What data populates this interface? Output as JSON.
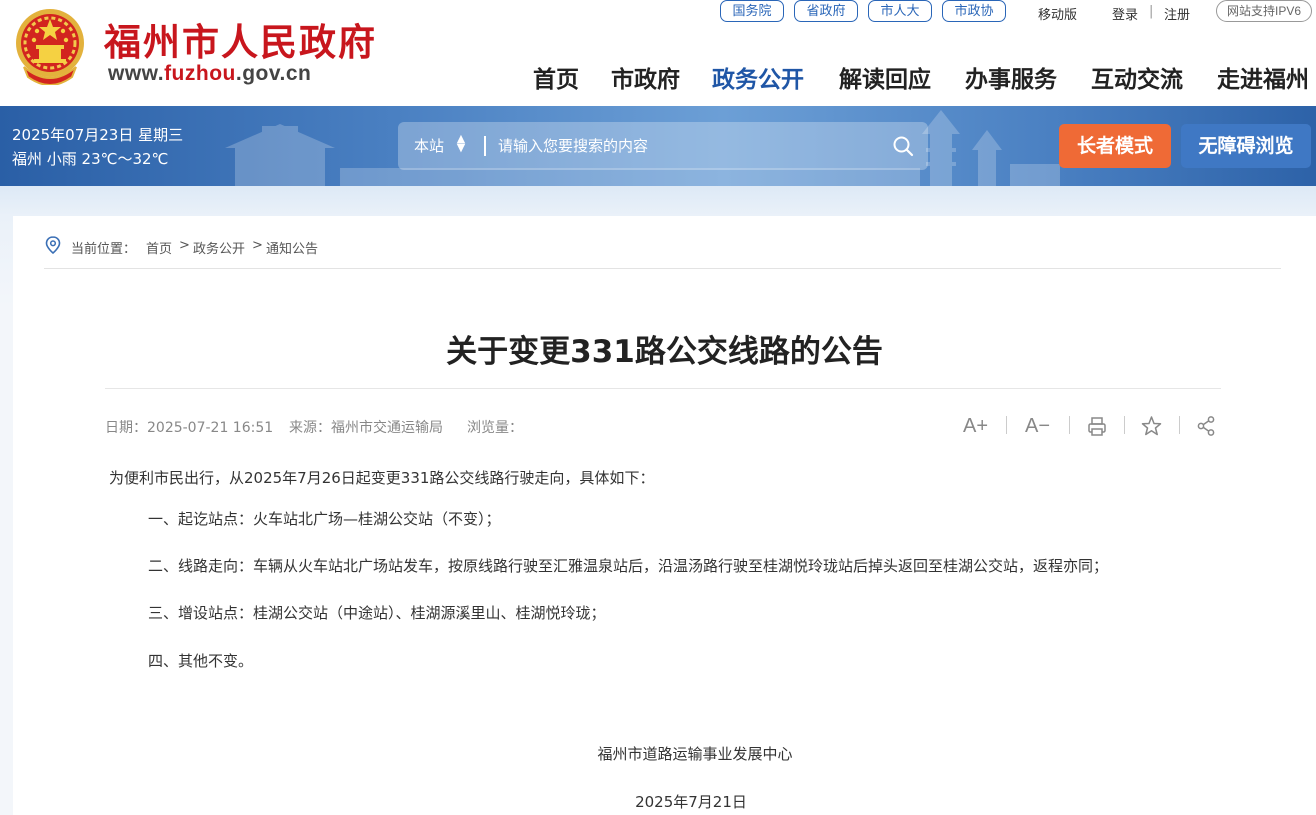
{
  "header": {
    "site_title": "福州市人民政府",
    "domain_prefix": "www.",
    "domain_highlight": "fuzhou",
    "domain_suffix": ".gov.cn",
    "top_links": [
      "国务院",
      "省政府",
      "市人大",
      "市政协"
    ],
    "mobile_label": "移动版",
    "login_label": "登录",
    "separator": "|",
    "register_label": "注册",
    "ipv6_label": "网站支持IPV6",
    "nav": [
      {
        "label": "首页",
        "active": false
      },
      {
        "label": "市政府",
        "active": false
      },
      {
        "label": "政务公开",
        "active": true
      },
      {
        "label": "解读回应",
        "active": false
      },
      {
        "label": "办事服务",
        "active": false
      },
      {
        "label": "互动交流",
        "active": false
      },
      {
        "label": "走进福州",
        "active": false
      }
    ],
    "emblem_icon": "national-emblem",
    "brand_color": "#c8161d",
    "nav_active_color": "#1f56a6"
  },
  "banner": {
    "date": "2025年07月23日 星期三",
    "weather": "福州 小雨 23℃～32℃",
    "search_scope": "本站",
    "search_placeholder": "请输入您要搜索的内容",
    "search_icon": "search-icon",
    "elder_mode_label": "长者模式",
    "accessibility_label": "无障碍浏览",
    "elder_color": "#ef6a36",
    "accessibility_color": "#3f78c4"
  },
  "breadcrumb": {
    "label": "当前位置：",
    "items": [
      "首页",
      "政务公开",
      "通知公告"
    ],
    "separator": ">"
  },
  "article": {
    "title": "关于变更331路公交线路的公告",
    "meta": {
      "date_label": "日期：",
      "date": "2025-07-21 16:51",
      "source_label": "来源：",
      "source": "福州市交通运输局",
      "views_label": "浏览量："
    },
    "tools": {
      "font_up": "A+",
      "font_down": "A−",
      "print_icon": "printer-icon",
      "favorite_icon": "star-icon",
      "share_icon": "share-icon"
    },
    "intro": "为便利市民出行，从2025年7月26日起变更331路公交线路行驶走向，具体如下：",
    "items": [
      "一、起讫站点：火车站北广场—桂湖公交站（不变）；",
      "二、线路走向：车辆从火车站北广场站发车，按原线路行驶至汇雅温泉站后，沿温汤路行驶至桂湖悦玲珑站后掉头返回至桂湖公交站，返程亦同；",
      "三、增设站点：桂湖公交站（中途站）、桂湖源溪里山、桂湖悦玲珑；",
      "四、其他不变。"
    ],
    "signature": "福州市道路运输事业发展中心",
    "sign_date": "2025年7月21日"
  }
}
